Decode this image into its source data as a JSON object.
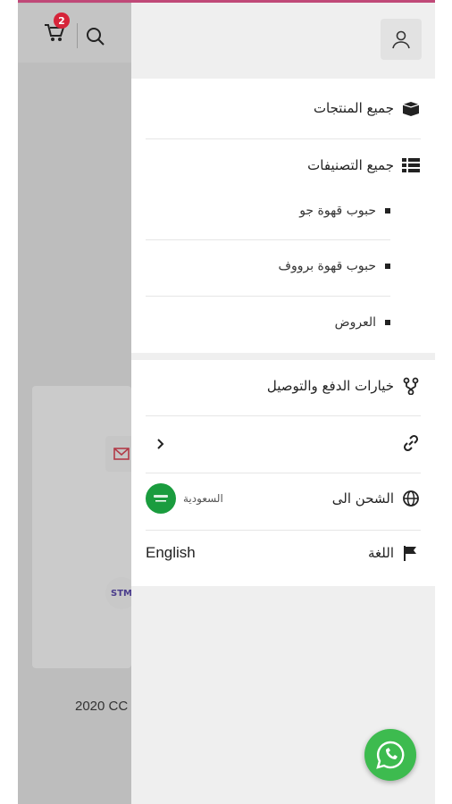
{
  "header": {
    "cart_count": "2",
    "cart_icon": "cart-icon",
    "search_icon": "search-icon"
  },
  "background": {
    "copyright": "2020 CC",
    "logo_text": "STM"
  },
  "drawer": {
    "user_icon": "user-icon",
    "menu": {
      "all_products": "جميع المنتجات",
      "all_categories": "جميع التصنيفات",
      "categories": [
        "حبوب قهوة جو",
        "حبوب قهوة برووف",
        "العروض"
      ],
      "payment_delivery": "خيارات الدفع والتوصيل",
      "ship_to_label": "الشحن الى",
      "ship_to_country": "السعودية",
      "language_label": "اللغة",
      "language_value": "English"
    }
  },
  "colors": {
    "accent": "#c2185b",
    "badge": "#d6243a",
    "whatsapp": "#3dbb4f",
    "saudi_green": "#1a9c3e"
  }
}
